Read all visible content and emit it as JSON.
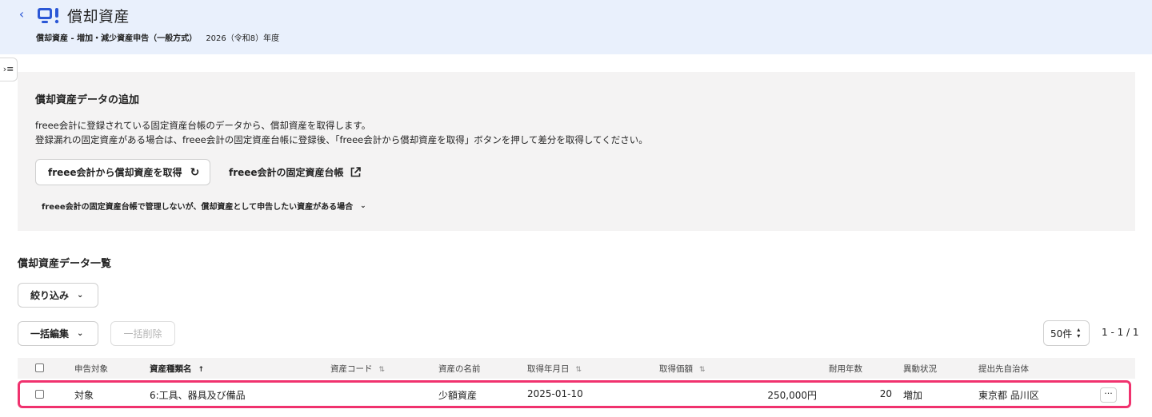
{
  "header": {
    "title": "償却資産",
    "subtitle": "償却資産 - 増加・減少資産申告（一般方式）",
    "fiscal_year": "2026（令和8）年度"
  },
  "add_section": {
    "title": "償却資産データの追加",
    "description_line1": "freee会計に登録されている固定資産台帳のデータから、償却資産を取得します。",
    "description_line2": "登録漏れの固定資産がある場合は、freee会計の固定資産台帳に登録後、「freee会計から償却資産を取得」ボタンを押して差分を取得してください。",
    "fetch_button": "freee会計から償却資産を取得",
    "ledger_link": "freee会計の固定資産台帳",
    "manual_toggle": "freee会計の固定資産台帳で管理しないが、償却資産として申告したい資産がある場合"
  },
  "list_section": {
    "title": "償却資産データ一覧",
    "filter_button": "絞り込み",
    "bulk_edit_button": "一括編集",
    "bulk_delete_button": "一括削除",
    "per_page": "50件",
    "range": "1 - 1 / 1"
  },
  "table": {
    "columns": {
      "target": "申告対象",
      "asset_type": "資産種類名",
      "asset_code": "資産コード",
      "asset_name": "資産の名前",
      "acquired_date": "取得年月日",
      "acquired_price": "取得価額",
      "useful_life": "耐用年数",
      "change_status": "異動状況",
      "municipality": "提出先自治体"
    },
    "rows": [
      {
        "target": "対象",
        "asset_type": "6:工具、器具及び備品",
        "asset_code": "",
        "asset_name": "少額資産",
        "acquired_date": "2025-01-10",
        "acquired_price": "250,000円",
        "useful_life": "20",
        "change_status": "増加",
        "municipality": "東京都 品川区"
      }
    ]
  },
  "icons": {
    "back": "chevron-left-icon",
    "app": "monitor-alert-icon",
    "refresh": "refresh-icon",
    "external": "external-link-icon",
    "menu_toggle": "menu-expand-icon",
    "more": "more-horizontal-icon"
  },
  "colors": {
    "header_bg": "#e9f0fc",
    "panel_bg": "#f4f3f3",
    "accent_blue": "#2b57d6",
    "highlight_row_border": "#f0326e"
  }
}
